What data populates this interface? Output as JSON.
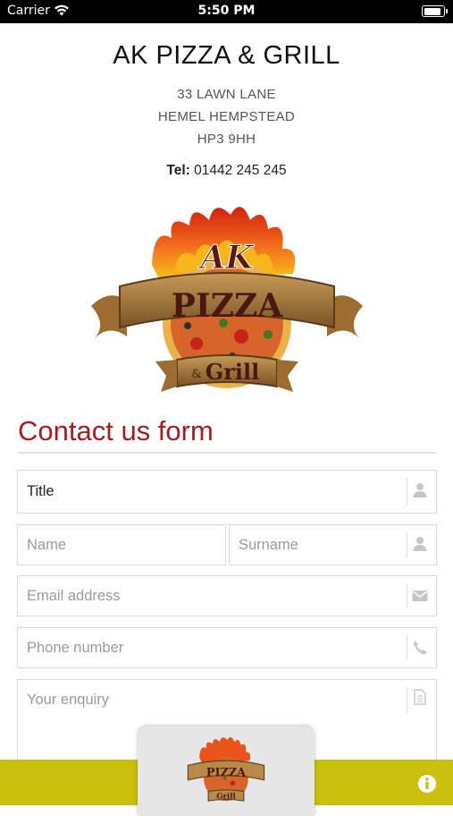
{
  "status_bar": {
    "carrier": "Carrier",
    "time": "5:50 PM"
  },
  "header": {
    "name": "AK PIZZA & GRILL",
    "address_line1": "33 LAWN LANE",
    "address_line2": "HEMEL HEMPSTEAD",
    "address_line3": "HP3 9HH",
    "tel_label": "Tel:",
    "tel_number": "01442 245 245"
  },
  "logo": {
    "line1": "AK",
    "line2": "PIZZA",
    "line3": "Grill",
    "amp": "&"
  },
  "form": {
    "title": "Contact us form",
    "title_field": {
      "value": "Title",
      "icon": "user-icon"
    },
    "name_field": {
      "placeholder": "Name"
    },
    "surname_field": {
      "placeholder": "Surname",
      "icon": "user-icon"
    },
    "email_field": {
      "placeholder": "Email address",
      "icon": "envelope-icon"
    },
    "phone_field": {
      "placeholder": "Phone number",
      "icon": "phone-icon"
    },
    "enquiry_field": {
      "placeholder": "Your enquiry",
      "icon": "document-icon"
    }
  },
  "bottom_bar": {
    "info_icon": "info-icon"
  },
  "colors": {
    "accent": "#a51c1c",
    "bar": "#c9bf0c"
  }
}
